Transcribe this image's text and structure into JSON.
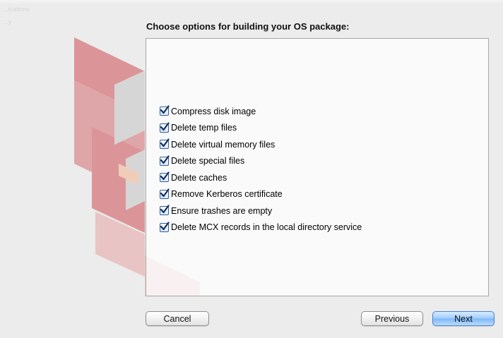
{
  "window": {
    "ghost_label_1": "...ications",
    "ghost_label_2": "...y"
  },
  "heading": "Choose options for building your OS package:",
  "options": [
    {
      "label": "Compress disk image",
      "checked": true
    },
    {
      "label": "Delete temp files",
      "checked": true
    },
    {
      "label": "Delete virtual memory files",
      "checked": true
    },
    {
      "label": "Delete special files",
      "checked": true
    },
    {
      "label": "Delete caches",
      "checked": true
    },
    {
      "label": "Remove Kerberos certificate",
      "checked": true
    },
    {
      "label": "Ensure trashes are empty",
      "checked": true
    },
    {
      "label": "Delete MCX records in the local directory service",
      "checked": true
    }
  ],
  "buttons": {
    "cancel": "Cancel",
    "previous": "Previous",
    "next": "Next"
  },
  "colors": {
    "logo_red": "#d9868a",
    "logo_grey": "#d3d3d3",
    "accent_blue": "#7db6f5"
  },
  "icons": {
    "checkbox": "checkmark-icon",
    "background_logo": "app-logo"
  }
}
